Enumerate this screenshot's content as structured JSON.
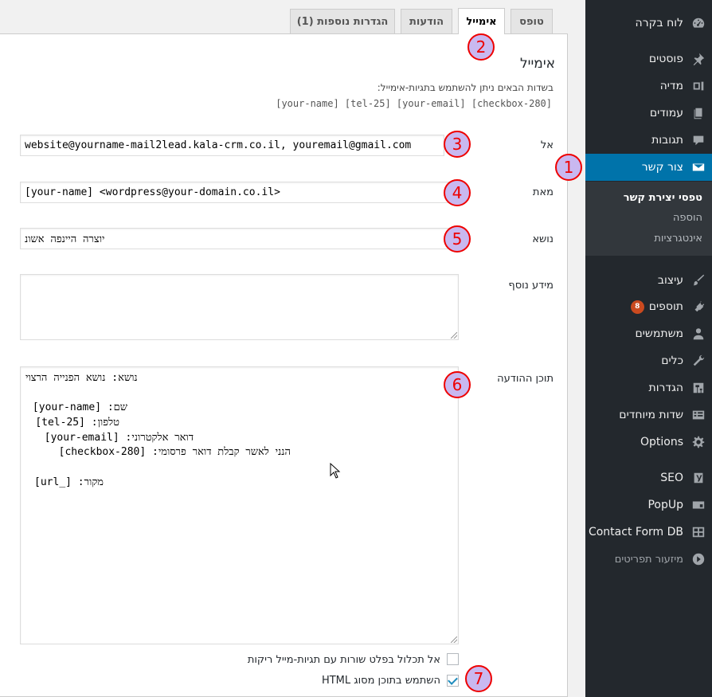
{
  "sidebar": {
    "items": [
      {
        "label": "לוח בקרה",
        "icon": "dashboard-icon"
      },
      {
        "label": "פוסטים",
        "icon": "pin-icon"
      },
      {
        "label": "מדיה",
        "icon": "media-icon"
      },
      {
        "label": "עמודים",
        "icon": "pages-icon"
      },
      {
        "label": "תגובות",
        "icon": "comments-icon"
      },
      {
        "label": "צור קשר",
        "icon": "mail-icon"
      },
      {
        "label": "עיצוב",
        "icon": "brush-icon"
      },
      {
        "label": "תוספים",
        "icon": "plugin-icon",
        "badge": "8"
      },
      {
        "label": "משתמשים",
        "icon": "users-icon"
      },
      {
        "label": "כלים",
        "icon": "wrench-icon"
      },
      {
        "label": "הגדרות",
        "icon": "settings-icon"
      },
      {
        "label": "שדות מיוחדים",
        "icon": "fields-icon"
      },
      {
        "label": "Options",
        "icon": "gear-icon"
      },
      {
        "label": "SEO",
        "icon": "yoast-icon"
      },
      {
        "label": "PopUp",
        "icon": "popup-icon"
      },
      {
        "label": "Contact Form DB",
        "icon": "db-icon"
      },
      {
        "label": "מיזעור תפריטים",
        "icon": "collapse-icon"
      }
    ],
    "submenu": [
      "טפסי יצירת קשר",
      "הוספה",
      "אינטגרציות"
    ]
  },
  "tabs": [
    "טופס",
    "אימייל",
    "הודעות",
    "הגדרות נוספות (1)"
  ],
  "email": {
    "title": "אימייל",
    "description": "בשדות הבאים ניתן להשתמש בתגיות-אימייל:",
    "tags": "[your-name] [tel-25] [your-email] [checkbox-280]",
    "to_label": "אל",
    "to_value": "website@yourname-mail2lead.kala-crm.co.il, youremail@gmail.com",
    "from_label": "מאת",
    "from_value": "[your-name] <wordpress@your-domain.co.il>",
    "subject_label": "נושא",
    "subject_value": "נושא הפנייה הרצוי",
    "headers_label": "מידע נוסף",
    "body_label": "תוכן ההודעה",
    "body_lines": [
      "נושא: נושא הפנייה הרצוי",
      "",
      "שם: [your-name]",
      "טלפון: [tel-25]",
      "דואר אלקטרוני: [your-email]",
      "הנני לאשר קבלת דואר פרסומי: [checkbox-280]",
      "",
      "מקור: [_url]"
    ],
    "exclude_blank_label": "אל תכלול בפלט שורות עם תגיות-מייל ריקות",
    "use_html_label": "השתמש בתוכן מסוג HTML"
  },
  "markers": [
    "1",
    "2",
    "3",
    "4",
    "5",
    "6",
    "7"
  ],
  "colors": {
    "sidebar": "#23282d",
    "active": "#0073aa",
    "marker_border": "#e00000",
    "marker_fill": "#c9b8f0"
  }
}
